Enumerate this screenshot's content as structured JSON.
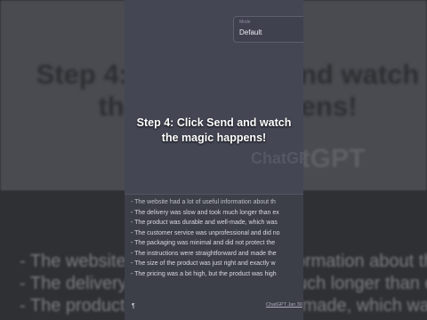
{
  "background": {
    "heading": "Step 4: Click Send and watch the magic happens!",
    "brand": "ChatGPT",
    "lines": [
      "- The website had a lot of useful information about the",
      "- The delivery was slow and took much longer than ex",
      "- The product was durable and well-made, which was"
    ]
  },
  "mode": {
    "label": "Mode",
    "value": "Default"
  },
  "watermark": "ChatGPT",
  "caption": {
    "line1": "Step 4: Click Send and watch",
    "line2": "the magic happens!"
  },
  "output": {
    "lines": [
      "- The website had a lot of useful information about th",
      "- The delivery was slow and took much longer than ex",
      "- The product was durable and well-made, which was",
      "- The customer service was unprofessional and did no",
      "- The packaging was minimal and did not protect the",
      "- The instructions were straightforward and made the",
      "- The size of the product was just right and exactly w",
      "- The pricing was a bit high, but the product was high"
    ],
    "cursor": "¶"
  },
  "footer": {
    "link": "ChatGPT Jan 30"
  },
  "colors": {
    "panel": "#444654",
    "textarea": "#3c3e48",
    "text": "#d9d9e3",
    "caption": "#ffffff"
  }
}
